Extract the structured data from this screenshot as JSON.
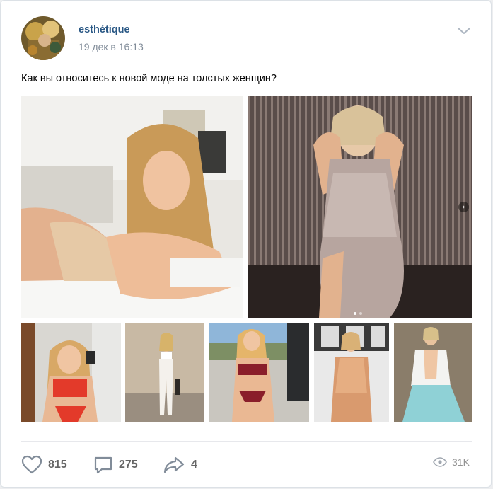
{
  "post": {
    "author": "esthétique",
    "date": "19 дек в 16:13",
    "text": "Как вы относитесь к новой моде на толстых женщин?"
  },
  "icons": {
    "menu": "chevron-down-icon",
    "like": "heart-icon",
    "comment": "comment-icon",
    "share": "share-arrow-icon",
    "views": "eye-icon",
    "carousel_next": "chevron-right-icon"
  },
  "actions": {
    "likes": "815",
    "comments": "275",
    "shares": "4",
    "views": "31K"
  },
  "carousel": {
    "next_symbol": "›",
    "dot_count": 2,
    "active_dot": 0
  },
  "colors": {
    "author_link": "#2a5885",
    "meta_gray": "#818c99",
    "action_gray": "#656565",
    "divider": "#e7e8ec"
  }
}
